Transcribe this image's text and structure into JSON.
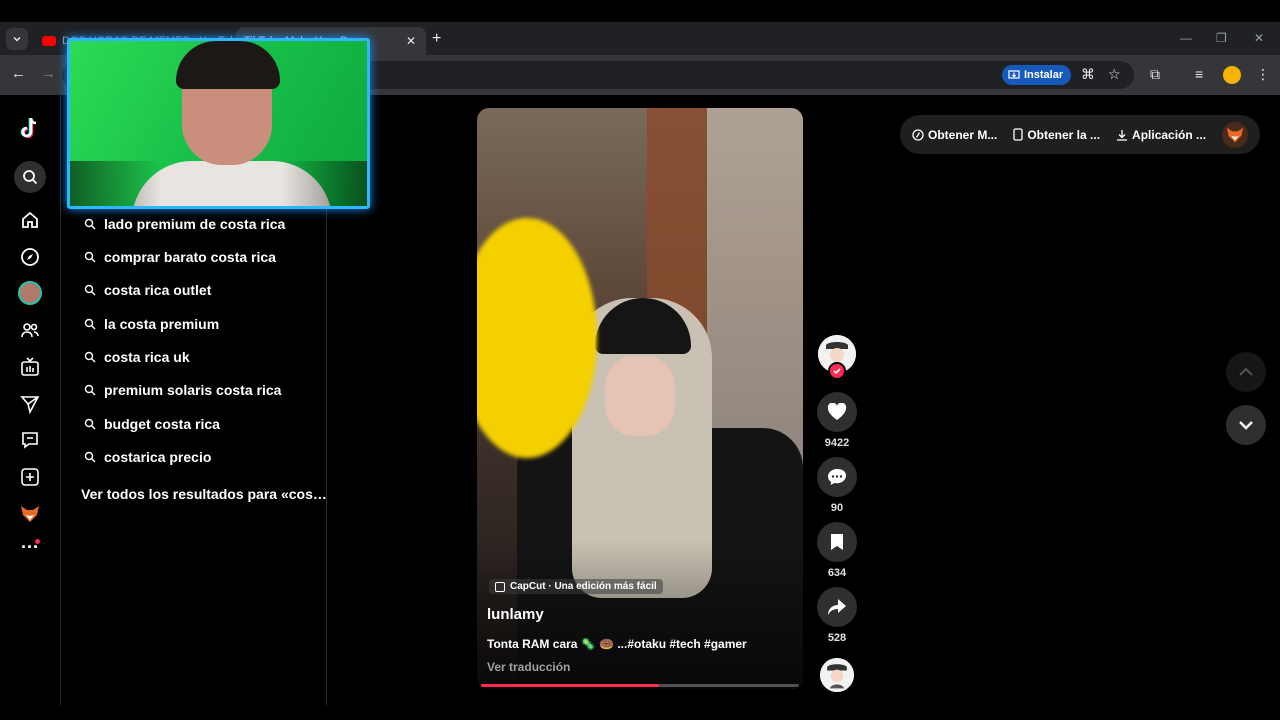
{
  "browser": {
    "tabs": [
      {
        "title": "DOS HORAS DE MEMES - YouTube"
      },
      {
        "title": "TikTok - Make Your Day"
      }
    ],
    "install_label": "Instalar"
  },
  "search_suggestions": [
    "lado premium de costa rica",
    "comprar barato costa rica",
    "costa rica outlet",
    "la costa premium",
    "costa rica uk",
    "premium solaris costa rica",
    "budget costa rica",
    "costarica precio"
  ],
  "see_all_label": "Ver todos los resultados para «cos…",
  "header_links": {
    "coins": "Obtener M...",
    "app": "Obtener la ...",
    "desktop": "Aplicación ..."
  },
  "video": {
    "capcut_label": "CapCut · Una edición más fácil",
    "username": "lunlamy",
    "description": "Tonta RAM cara 🦠 🍩 ...#otaku #tech #gamer",
    "translate_label": "Ver traducción",
    "progress_percent": 56
  },
  "actions": {
    "likes": "9422",
    "comments": "90",
    "saves": "634",
    "shares": "528"
  },
  "colors": {
    "accent": "#fe2c55",
    "webcam_border": "#2bb8ff",
    "install_button": "#185abc"
  }
}
